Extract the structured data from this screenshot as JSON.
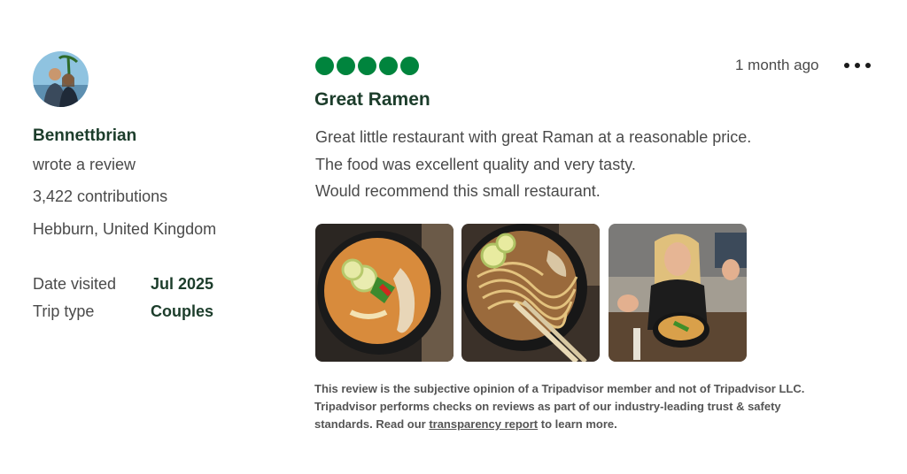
{
  "reviewer": {
    "name": "Bennettbrian",
    "action": "wrote a review",
    "contributions": "3,422 contributions",
    "location": "Hebburn, United Kingdom",
    "details": [
      {
        "label": "Date visited",
        "value": "Jul 2025"
      },
      {
        "label": "Trip type",
        "value": "Couples"
      }
    ]
  },
  "review": {
    "rating": 5,
    "time_ago": "1 month ago",
    "title": "Great Ramen",
    "lines": [
      "Great little restaurant with great Raman at a reasonable price.",
      "The food was excellent quality and very tasty.",
      "Would recommend this small restaurant."
    ],
    "photos": [
      "ramen-bowl-photo",
      "noodles-chopsticks-photo",
      "diner-with-bowl-photo"
    ]
  },
  "disclaimer": {
    "line1": "This review is the subjective opinion of a Tripadvisor member and not of Tripadvisor LLC.",
    "line2": "Tripadvisor performs checks on reviews as part of our industry-leading trust & safety",
    "line3_pre": "standards. Read our ",
    "link": "transparency report",
    "line3_post": " to learn more."
  },
  "colors": {
    "brand_green": "#00843d",
    "heading_green": "#1c3d2b"
  },
  "icons": {
    "more": "more-options-icon",
    "rating": "rating-bubble-icon"
  }
}
